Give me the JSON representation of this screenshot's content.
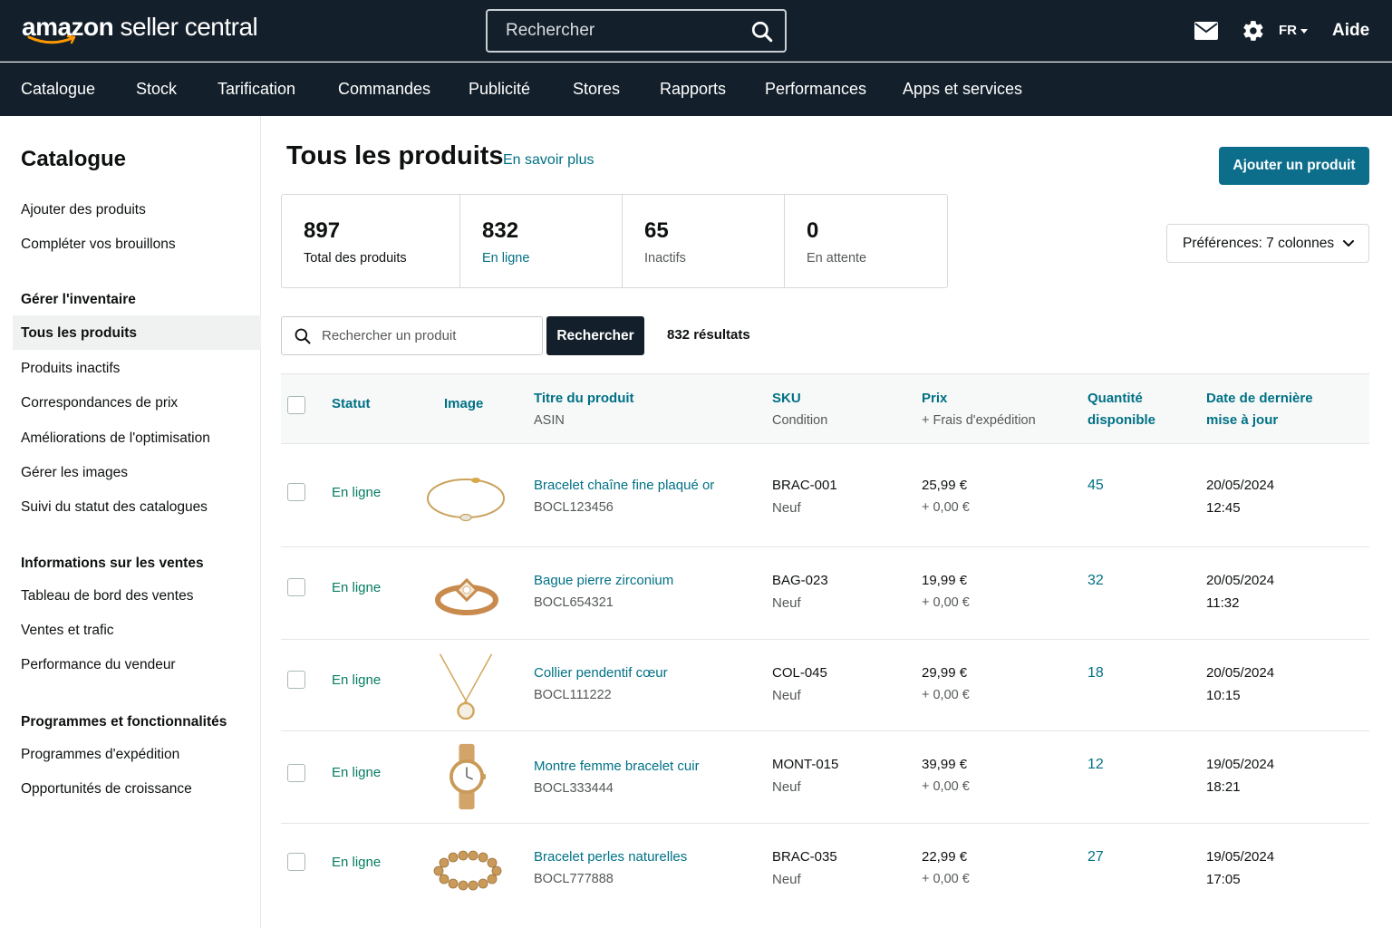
{
  "header": {
    "logo_brand": "amazon",
    "logo_rest": " seller central",
    "search_placeholder": "Rechercher",
    "language": "FR",
    "help": "Aide"
  },
  "nav": [
    "Catalogue",
    "Stock",
    "Tarification",
    "Commandes",
    "Publicité",
    "Stores",
    "Rapports",
    "Performances",
    "Apps et services"
  ],
  "sidebar": {
    "title": "Catalogue",
    "items_top": [
      "Ajouter des produits",
      "Compléter vos brouillons"
    ],
    "section_inventory": "Gérer l'inventaire",
    "items_inventory": [
      "Tous les produits",
      "Produits inactifs",
      "Correspondances de prix",
      "Améliorations de l'optimisation",
      "Gérer les images",
      "Suivi du statut des catalogues"
    ],
    "section_sales": "Informations sur les ventes",
    "items_sales": [
      "Tableau de bord des ventes",
      "Ventes et trafic",
      "Performance du vendeur"
    ],
    "section_programs": "Programmes et fonctionnalités",
    "items_programs": [
      "Programmes d'expédition",
      "Opportunités de croissance"
    ]
  },
  "main": {
    "title": "Tous les produits",
    "learn_more": "En savoir plus",
    "add_button": "Ajouter un produit",
    "stats": [
      {
        "value": "897",
        "label": "Total des produits"
      },
      {
        "value": "832",
        "label": "En ligne"
      },
      {
        "value": "65",
        "label": "Inactifs"
      },
      {
        "value": "0",
        "label": "En attente"
      }
    ],
    "preferences": "Préférences: 7 colonnes",
    "product_search_placeholder": "Rechercher un produit",
    "search_button": "Rechercher",
    "results": "832 résultats"
  },
  "table": {
    "headers": {
      "status": "Statut",
      "image": "Image",
      "title": "Titre du produit",
      "title_sub": "ASIN",
      "sku": "SKU",
      "sku_sub": "Condition",
      "price": "Prix",
      "price_sub": "+ Frais d'expédition",
      "qty_line1": "Quantité",
      "qty_line2": "disponible",
      "date_line1": "Date de dernière",
      "date_line2": "mise à jour"
    },
    "rows": [
      {
        "status": "En ligne",
        "image": "bracelet-chain-image",
        "title": "Bracelet chaîne fine plaqué or",
        "asin": "BOCL123456",
        "sku": "BRAC-001",
        "condition": "Neuf",
        "price": "25,99 €",
        "shipping": "+ 0,00 €",
        "qty": "45",
        "date": "20/05/2024",
        "time": "12:45"
      },
      {
        "status": "En ligne",
        "image": "ring-image",
        "title": "Bague pierre zirconium",
        "asin": "BOCL654321",
        "sku": "BAG-023",
        "condition": "Neuf",
        "price": "19,99 €",
        "shipping": "+ 0,00 €",
        "qty": "32",
        "date": "20/05/2024",
        "time": "11:32"
      },
      {
        "status": "En ligne",
        "image": "necklace-image",
        "title": "Collier pendentif cœur",
        "asin": "BOCL111222",
        "sku": "COL-045",
        "condition": "Neuf",
        "price": "29,99 €",
        "shipping": "+ 0,00 €",
        "qty": "18",
        "date": "20/05/2024",
        "time": "10:15"
      },
      {
        "status": "En ligne",
        "image": "watch-image",
        "title": "Montre femme bracelet cuir",
        "asin": "BOCL333444",
        "sku": "MONT-015",
        "condition": "Neuf",
        "price": "39,99 €",
        "shipping": "+ 0,00 €",
        "qty": "12",
        "date": "19/05/2024",
        "time": "18:21"
      },
      {
        "status": "En ligne",
        "image": "pearl-bracelet-image",
        "title": "Bracelet perles naturelles",
        "asin": "BOCL777888",
        "sku": "BRAC-035",
        "condition": "Neuf",
        "price": "22,99 €",
        "shipping": "+ 0,00 €",
        "qty": "27",
        "date": "19/05/2024",
        "time": "17:05"
      }
    ]
  },
  "colors": {
    "header_bg": "#131f2a",
    "link": "#007185",
    "status_green": "#067d62",
    "primary_button": "#0d6e8c"
  }
}
